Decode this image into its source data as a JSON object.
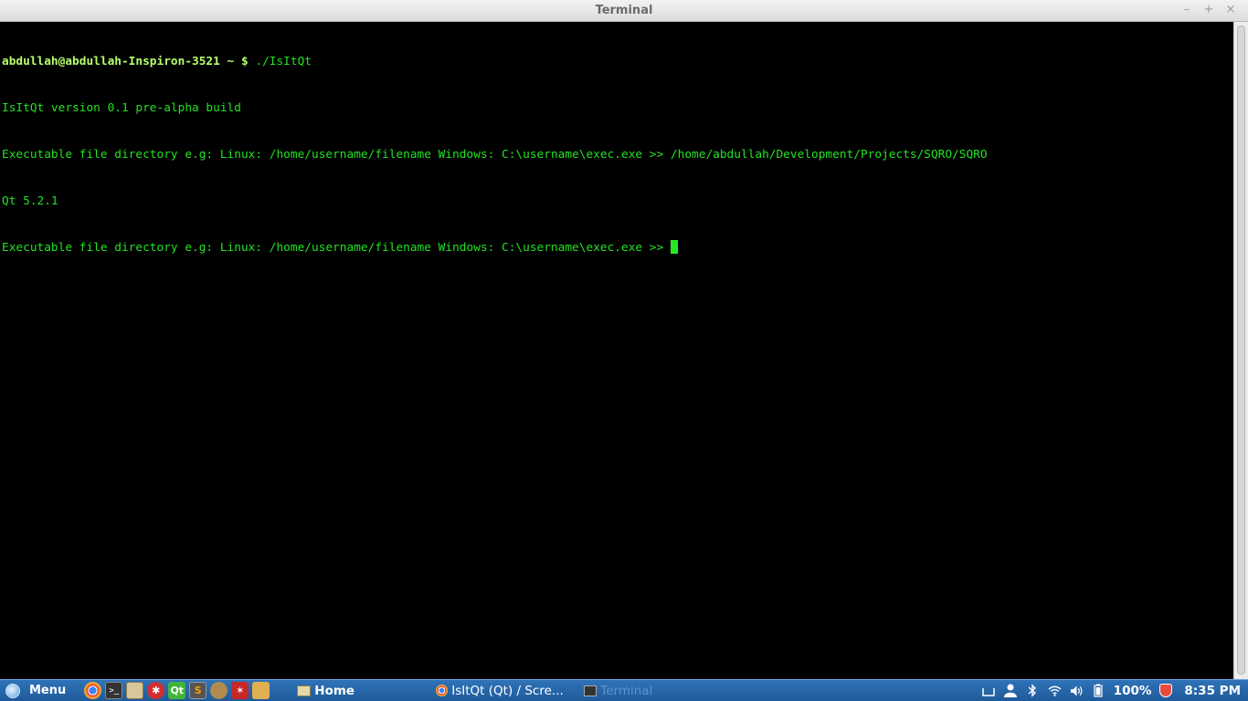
{
  "window": {
    "title": "Terminal",
    "controls": {
      "minimize": "–",
      "maximize": "+",
      "close": "×"
    }
  },
  "terminal": {
    "prompt": "abdullah@abdullah-Inspiron-3521 ~ $",
    "command": " ./IsItQt",
    "lines": [
      "IsItQt version 0.1 pre-alpha build",
      "Executable file directory e.g: Linux: /home/username/filename Windows: C:\\username\\exec.exe >> /home/abdullah/Development/Projects/SQRO/SQRO",
      "Qt 5.2.1",
      "Executable file directory e.g: Linux: /home/username/filename Windows: C:\\username\\exec.exe >> "
    ],
    "colors": {
      "background": "#000000",
      "text": "#22e322",
      "prompt": "#b6ff6d",
      "cursor": "#25e825"
    }
  },
  "taskbar": {
    "menu_label": "Menu",
    "launchers": [
      {
        "name": "chrome-icon",
        "glyph": ""
      },
      {
        "name": "terminal-icon",
        "glyph": ">_"
      },
      {
        "name": "files-icon",
        "glyph": ""
      },
      {
        "name": "bug-icon",
        "glyph": "✱"
      },
      {
        "name": "qt-creator-icon",
        "glyph": "Qt"
      },
      {
        "name": "sublime-icon",
        "glyph": "S"
      },
      {
        "name": "gimp-icon",
        "glyph": ""
      },
      {
        "name": "red-app-icon",
        "glyph": "✶"
      },
      {
        "name": "yellow-app-icon",
        "glyph": ""
      }
    ],
    "tasks": [
      {
        "label": "Home"
      },
      {
        "label": "IsItQt (Qt) / Scre..."
      },
      {
        "label": "Terminal"
      }
    ],
    "tray": {
      "battery": "100%",
      "clock": "8:35 PM"
    },
    "colors": {
      "bar": "#2a68ab",
      "inactive_task_text": "#5d94cc"
    }
  }
}
